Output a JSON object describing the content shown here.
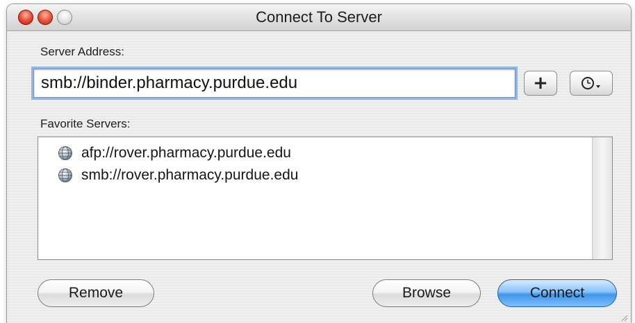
{
  "window": {
    "title": "Connect To Server"
  },
  "server_address": {
    "label": "Server Address:",
    "value": "smb://binder.pharmacy.purdue.edu",
    "add_button_label": "+",
    "recent_icon": "clock-icon"
  },
  "favorites": {
    "label": "Favorite Servers:",
    "items": [
      {
        "icon": "network-globe-icon",
        "label": "afp://rover.pharmacy.purdue.edu"
      },
      {
        "icon": "network-globe-icon",
        "label": "smb://rover.pharmacy.purdue.edu"
      }
    ]
  },
  "buttons": {
    "remove_label": "Remove",
    "browse_label": "Browse",
    "connect_label": "Connect"
  },
  "colors": {
    "focus_ring": "#8fb8e8",
    "default_button": "#3f95ea"
  }
}
